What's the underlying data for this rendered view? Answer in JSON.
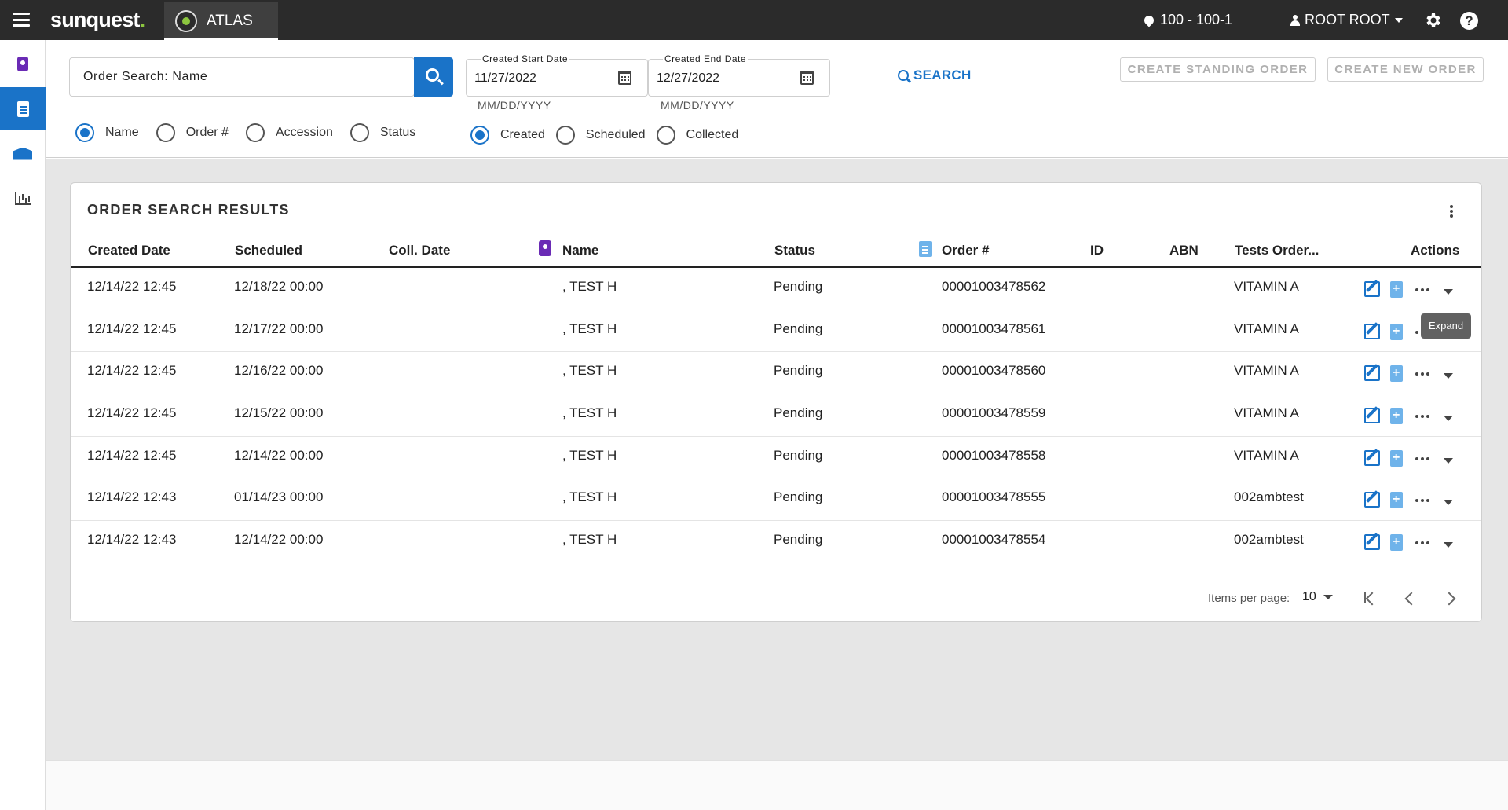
{
  "topbar": {
    "logo_main": "sunquest",
    "logo_dot": ".",
    "app_name": "ATLAS",
    "location": "100 - 100-1",
    "user": "ROOT ROOT",
    "help_label": "?"
  },
  "search": {
    "placeholder": "Order Search: Name",
    "type_options": [
      {
        "label": "Name",
        "checked": true
      },
      {
        "label": "Order #",
        "checked": false
      },
      {
        "label": "Accession",
        "checked": false
      },
      {
        "label": "Status",
        "checked": false
      }
    ],
    "start_date": {
      "label": "Created Start Date",
      "value": "11/27/2022",
      "hint": "MM/DD/YYYY"
    },
    "end_date": {
      "label": "Created End Date",
      "value": "12/27/2022",
      "hint": "MM/DD/YYYY"
    },
    "date_type_options": [
      {
        "label": "Created",
        "checked": true
      },
      {
        "label": "Scheduled",
        "checked": false
      },
      {
        "label": "Collected",
        "checked": false
      }
    ],
    "search_label": "SEARCH",
    "create_standing_label": "CREATE STANDING ORDER",
    "create_new_label": "CREATE NEW ORDER"
  },
  "results": {
    "title": "ORDER SEARCH RESULTS",
    "columns": {
      "created": "Created Date",
      "scheduled": "Scheduled",
      "coll_date": "Coll. Date",
      "name": "Name",
      "status": "Status",
      "order": "Order #",
      "id": "ID",
      "abn": "ABN",
      "tests": "Tests Order...",
      "actions": "Actions"
    },
    "rows": [
      {
        "created": "12/14/22 12:45",
        "scheduled": "12/18/22 00:00",
        "coll_date": "",
        "name": ", TEST H",
        "status": "Pending",
        "order": "00001003478562",
        "id": "",
        "abn": "",
        "tests": "VITAMIN A"
      },
      {
        "created": "12/14/22 12:45",
        "scheduled": "12/17/22 00:00",
        "coll_date": "",
        "name": ", TEST H",
        "status": "Pending",
        "order": "00001003478561",
        "id": "",
        "abn": "",
        "tests": "VITAMIN A"
      },
      {
        "created": "12/14/22 12:45",
        "scheduled": "12/16/22 00:00",
        "coll_date": "",
        "name": ", TEST H",
        "status": "Pending",
        "order": "00001003478560",
        "id": "",
        "abn": "",
        "tests": "VITAMIN A"
      },
      {
        "created": "12/14/22 12:45",
        "scheduled": "12/15/22 00:00",
        "coll_date": "",
        "name": ", TEST H",
        "status": "Pending",
        "order": "00001003478559",
        "id": "",
        "abn": "",
        "tests": "VITAMIN A"
      },
      {
        "created": "12/14/22 12:45",
        "scheduled": "12/14/22 00:00",
        "coll_date": "",
        "name": ", TEST H",
        "status": "Pending",
        "order": "00001003478558",
        "id": "",
        "abn": "",
        "tests": "VITAMIN A"
      },
      {
        "created": "12/14/22 12:43",
        "scheduled": "01/14/23 00:00",
        "coll_date": "",
        "name": ", TEST H",
        "status": "Pending",
        "order": "00001003478555",
        "id": "",
        "abn": "",
        "tests": "002ambtest"
      },
      {
        "created": "12/14/22 12:43",
        "scheduled": "12/14/22 00:00",
        "coll_date": "",
        "name": ", TEST H",
        "status": "Pending",
        "order": "00001003478554",
        "id": "",
        "abn": "",
        "tests": "002ambtest"
      }
    ],
    "tooltip": "Expand",
    "paginator": {
      "label": "Items per page:",
      "page_size": "10"
    }
  },
  "colors": {
    "accent": "#1a73c8",
    "topbar": "#2b2b2b",
    "brand_green": "#8cc63f",
    "patient_purple": "#6a2bb5"
  },
  "icons": [
    "menu-icon",
    "atlas-icon",
    "location-pin-icon",
    "person-icon",
    "gear-icon",
    "help-icon",
    "search-icon",
    "calendar-icon",
    "patient-badge-icon",
    "clipboard-icon",
    "box-icon",
    "chart-icon",
    "kebab-icon",
    "edit-icon",
    "add-clipboard-icon",
    "more-icon",
    "expand-icon",
    "first-page-icon",
    "prev-page-icon",
    "next-page-icon"
  ]
}
